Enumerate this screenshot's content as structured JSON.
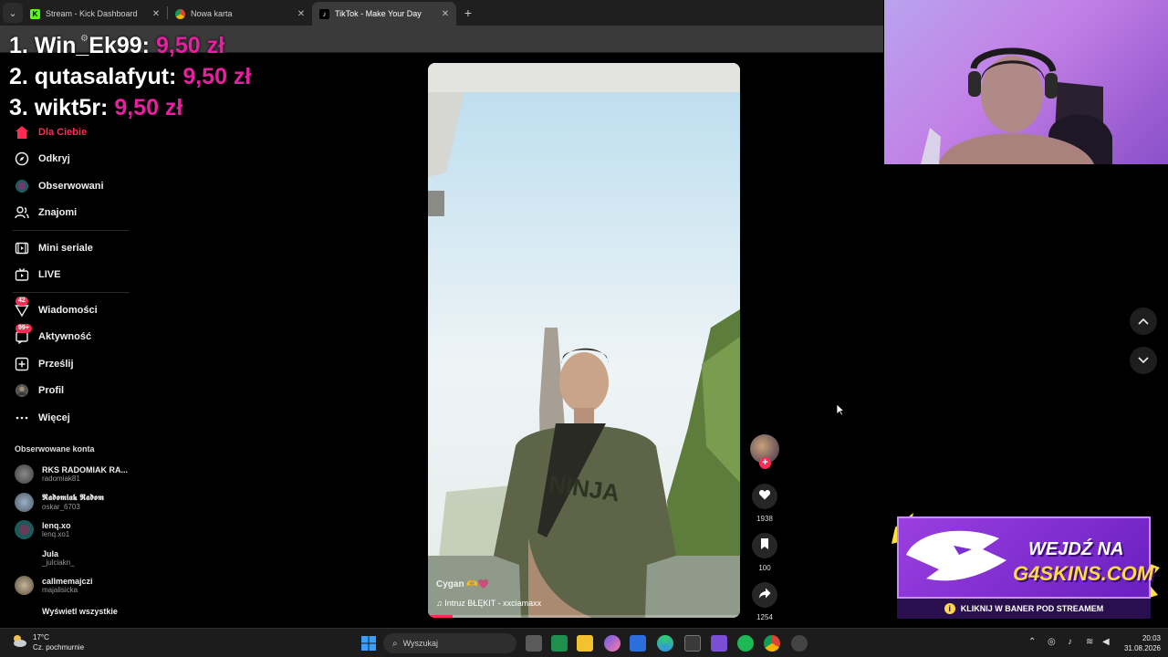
{
  "browser": {
    "tabs": [
      {
        "title": "Stream - Kick Dashboard",
        "icon": "kick-icon",
        "active": false
      },
      {
        "title": "Nowa karta",
        "icon": "chrome-icon",
        "active": false
      },
      {
        "title": "TikTok - Make Your Day",
        "icon": "tiktok-icon",
        "active": true
      }
    ],
    "close_glyph": "✕",
    "new_tab_glyph": "+"
  },
  "overlay": {
    "leaderboard": [
      {
        "name": "1. Win_Ek99:",
        "amount": "9,50 zł"
      },
      {
        "name": "2. qutasalafyut:",
        "amount": "9,50 zł"
      },
      {
        "name": "3. wikt5r:",
        "amount": "9,50 zł"
      }
    ]
  },
  "sidebar": {
    "nav": [
      {
        "label": "Dla Ciebie",
        "icon": "home-icon",
        "active": true
      },
      {
        "label": "Odkryj",
        "icon": "compass-icon"
      },
      {
        "label": "Obserwowani",
        "icon": "following-avatar-icon"
      },
      {
        "label": "Znajomi",
        "icon": "friends-icon"
      },
      {
        "label": "Mini seriale",
        "icon": "film-icon"
      },
      {
        "label": "LIVE",
        "icon": "live-tv-icon"
      },
      {
        "label": "Wiadomości",
        "icon": "message-icon",
        "badge": "42"
      },
      {
        "label": "Aktywność",
        "icon": "activity-icon",
        "badge": "99+"
      },
      {
        "label": "Prześlij",
        "icon": "upload-icon"
      },
      {
        "label": "Profil",
        "icon": "profile-avatar-icon"
      },
      {
        "label": "Więcej",
        "icon": "more-icon"
      }
    ],
    "followed_title": "Obserwowane konta",
    "followed": [
      {
        "name": "RKS RADOMIAK RA...",
        "handle": "radomiak81"
      },
      {
        "name": "𝕽𝖆𝖉𝖔𝖒𝖎𝖆𝖐 𝕽𝖆𝖉𝖔𝖒",
        "handle": "oskar_6703"
      },
      {
        "name": "lenq.xo",
        "handle": "lenq.xo1"
      },
      {
        "name": "Jula",
        "handle": "_julciakn_"
      },
      {
        "name": "callmemajczi",
        "handle": "majalisicka"
      }
    ],
    "see_all": "Wyświetl wszystkie"
  },
  "video": {
    "caption_user": "Cygan 🫶💗",
    "music": "♫  Intruz BŁĘKIT - xxciamaxx",
    "progress": 0.08
  },
  "actions": {
    "likes": "1938",
    "saves": "100",
    "shares": "1254"
  },
  "ad": {
    "title1": "WEJDŹ NA",
    "title2": "G4SKINS.COM",
    "strip": "KLIKNIJ W BANER POD STREAMEM",
    "info_glyph": "i"
  },
  "taskbar": {
    "weather_temp": "17°C",
    "weather_desc": "Cz. pochmurnie",
    "search_placeholder": "Wyszukaj",
    "time": "20:03",
    "date": "31.08.2026"
  }
}
